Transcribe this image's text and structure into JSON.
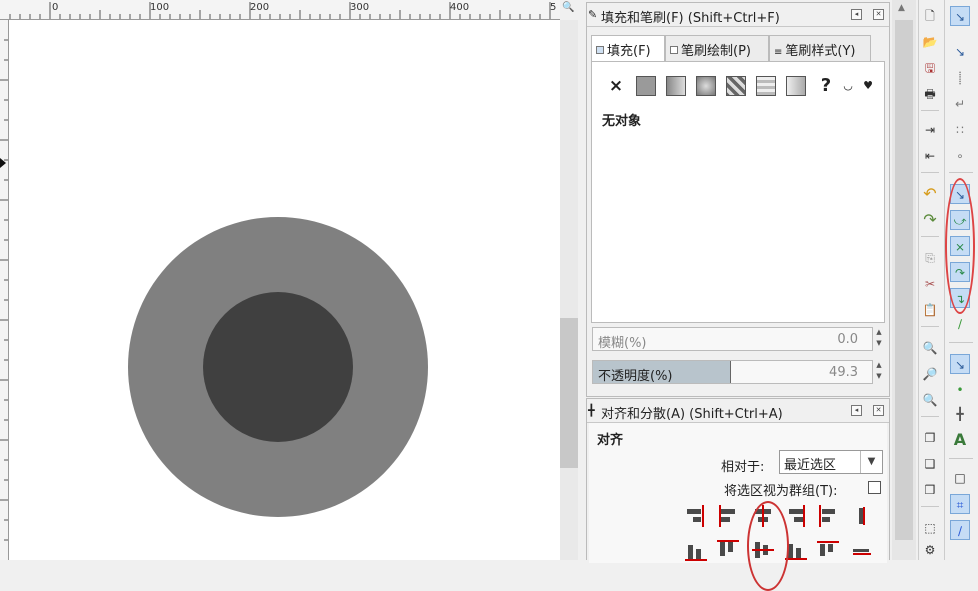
{
  "ruler": {
    "ticks": [
      "0",
      "100",
      "200",
      "300",
      "400",
      "5"
    ]
  },
  "canvas": {
    "outer_fill": "#808080",
    "inner_fill": "#404040",
    "zoom_icon": "zoom-icon"
  },
  "fill_stroke": {
    "title": "填充和笔刷(F) (Shift+Ctrl+F)",
    "tabs": [
      "填充(F)",
      "笔刷绘制(P)",
      "笔刷样式(Y)"
    ],
    "paint_types": [
      "no-paint-icon",
      "flat-color-icon",
      "linear-gradient-icon",
      "radial-gradient-icon",
      "pattern-icon",
      "swatch-icon",
      "unset-icon",
      "evenodd-icon",
      "nonzero-icon"
    ],
    "unset_symbol": "?",
    "no_paint_symbol": "×",
    "status": "无对象",
    "blur_label": "模糊(%)",
    "blur_value": "0.0",
    "opacity_label": "不透明度(%)",
    "opacity_value": "49.3",
    "opacity_fraction": 0.493
  },
  "align": {
    "title": "对齐和分散(A) (Shift+Ctrl+A)",
    "heading": "对齐",
    "relative_label": "相对于:",
    "relative_value": "最近选区",
    "group_label": "将选区视为群组(T):",
    "group_checked": false
  },
  "toolbar": {
    "commands": [
      "new-document-icon",
      "open-icon",
      "save-icon",
      "print-icon",
      "import-icon",
      "export-icon",
      "undo-icon",
      "redo-icon",
      "copy-icon",
      "cut-icon",
      "paste-icon",
      "zoom-selection-icon",
      "zoom-drawing-icon",
      "zoom-page-icon",
      "duplicate-icon",
      "group-icon",
      "ungroup-icon",
      "fill-stroke-icon",
      "document-props-icon"
    ],
    "snaps": [
      "snap-toggle-icon",
      "snap-bbox-icon",
      "snap-bbox-edge-icon",
      "snap-bbox-corner-icon",
      "snap-bbox-midpoint-icon",
      "snap-bbox-center-icon",
      "snap-nodes-icon",
      "snap-paths-icon",
      "snap-intersection-icon",
      "snap-cusp-icon",
      "snap-smooth-icon",
      "snap-midpoint-icon",
      "snap-object-center-icon",
      "snap-rotation-center-icon",
      "snap-text-baseline-icon",
      "snap-page-border-icon",
      "snap-grid-icon",
      "snap-guide-icon"
    ],
    "accent": "#c5dcf5",
    "highlight_color": "#d44"
  }
}
